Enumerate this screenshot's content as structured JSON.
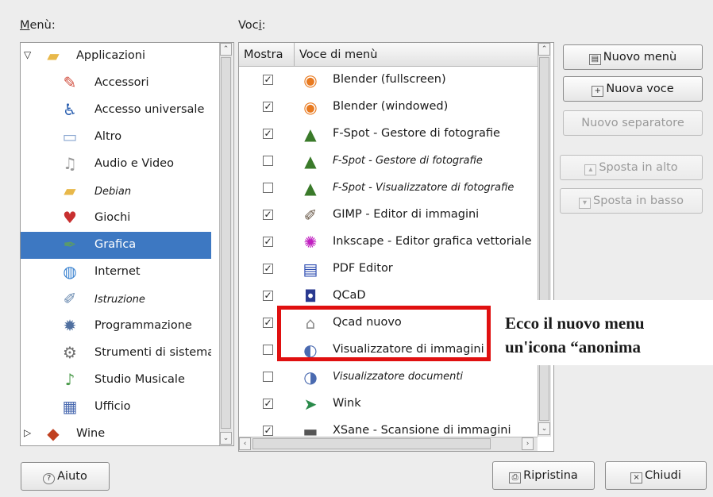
{
  "menu_label": "Menù:",
  "items_label": "Voci:",
  "tree": [
    {
      "label": "Applicazioni",
      "icon": "folder-icon",
      "expander": "▽",
      "italic": false,
      "selected": false
    },
    {
      "label": "Accessori",
      "icon": "accessories-icon",
      "italic": false,
      "selected": false
    },
    {
      "label": "Accesso universale",
      "icon": "accessibility-icon",
      "italic": false,
      "selected": false
    },
    {
      "label": "Altro",
      "icon": "other-icon",
      "italic": false,
      "selected": false
    },
    {
      "label": "Audio e Video",
      "icon": "multimedia-icon",
      "italic": false,
      "selected": false
    },
    {
      "label": "Debian",
      "icon": "folder-icon",
      "italic": true,
      "selected": false
    },
    {
      "label": "Giochi",
      "icon": "games-icon",
      "italic": false,
      "selected": false
    },
    {
      "label": "Grafica",
      "icon": "graphics-icon",
      "italic": false,
      "selected": true
    },
    {
      "label": "Internet",
      "icon": "internet-icon",
      "italic": false,
      "selected": false
    },
    {
      "label": "Istruzione",
      "icon": "education-icon",
      "italic": true,
      "selected": false
    },
    {
      "label": "Programmazione",
      "icon": "development-icon",
      "italic": false,
      "selected": false
    },
    {
      "label": "Strumenti di sistema",
      "icon": "system-tools-icon",
      "italic": false,
      "selected": false
    },
    {
      "label": "Studio Musicale",
      "icon": "music-icon",
      "italic": false,
      "selected": false
    },
    {
      "label": "Ufficio",
      "icon": "office-icon",
      "italic": false,
      "selected": false
    },
    {
      "label": "Wine",
      "icon": "wine-icon",
      "expander": "▷",
      "italic": false,
      "selected": false
    }
  ],
  "columns": {
    "show": "Mostra",
    "item": "Voce di menù"
  },
  "entries": [
    {
      "label": "Blender (fullscreen)",
      "checked": true,
      "italic": false,
      "icon": "blender-icon"
    },
    {
      "label": "Blender (windowed)",
      "checked": true,
      "italic": false,
      "icon": "blender-icon"
    },
    {
      "label": "F-Spot - Gestore di fotografie",
      "checked": true,
      "italic": false,
      "icon": "fspot-icon"
    },
    {
      "label": "F-Spot - Gestore di fotografie",
      "checked": false,
      "italic": true,
      "icon": "fspot-icon"
    },
    {
      "label": "F-Spot - Visualizzatore di fotografie",
      "checked": false,
      "italic": true,
      "icon": "fspot-icon"
    },
    {
      "label": "GIMP - Editor di immagini",
      "checked": true,
      "italic": false,
      "icon": "gimp-icon"
    },
    {
      "label": "Inkscape - Editor grafica vettoriale",
      "checked": true,
      "italic": false,
      "icon": "inkscape-icon"
    },
    {
      "label": "PDF Editor",
      "checked": true,
      "italic": false,
      "icon": "pdf-editor-icon"
    },
    {
      "label": "QCaD",
      "checked": true,
      "italic": false,
      "icon": "qcad-icon"
    },
    {
      "label": "Qcad nuovo",
      "checked": true,
      "italic": false,
      "icon": "generic-app-icon"
    },
    {
      "label": "Visualizzatore di immagini",
      "checked": false,
      "italic": false,
      "icon": "image-viewer-icon"
    },
    {
      "label": "Visualizzatore documenti",
      "checked": false,
      "italic": true,
      "icon": "document-viewer-icon"
    },
    {
      "label": "Wink",
      "checked": true,
      "italic": false,
      "icon": "wink-icon"
    },
    {
      "label": "XSane - Scansione di immagini",
      "checked": true,
      "italic": false,
      "icon": "xsane-icon"
    }
  ],
  "buttons": {
    "new_menu": "Nuovo menù",
    "new_item": "Nuova voce",
    "new_separator": "Nuovo separatore",
    "move_up": "Sposta in alto",
    "move_down": "Sposta in basso",
    "help": "Aiuto",
    "revert": "Ripristina",
    "close": "Chiudi"
  },
  "annotation": {
    "line1": "Ecco il nuovo menu",
    "line2": "un'icona “anonima",
    "highlight_color": "#e01010"
  },
  "colors": {
    "selection": "#3d78c2",
    "window_bg": "#ededed"
  }
}
